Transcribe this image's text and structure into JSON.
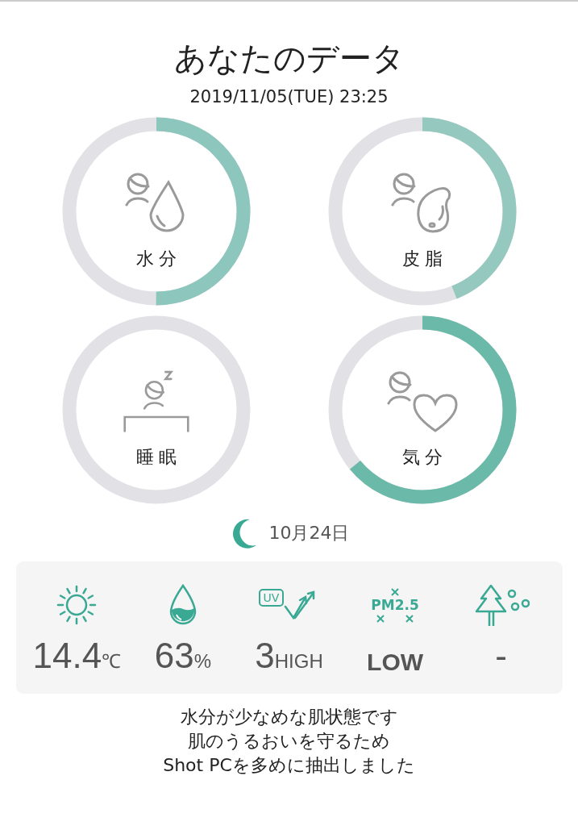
{
  "title": "あなたのデータ",
  "datetime": "2019/11/05(TUE) 23:25",
  "rings": [
    {
      "kind": "moisture",
      "label": "水分"
    },
    {
      "kind": "sebum",
      "label": "皮脂"
    },
    {
      "kind": "sleep",
      "label": "睡眠"
    },
    {
      "kind": "mood",
      "label": "気分"
    }
  ],
  "moon_date": "10月24日",
  "weather": [
    {
      "kind": "temperature",
      "value": "14.4",
      "unit": "℃"
    },
    {
      "kind": "humidity",
      "value": "63",
      "unit": "%"
    },
    {
      "kind": "uv",
      "icon_text": "UV",
      "value": "3",
      "unit": "HIGH"
    },
    {
      "kind": "pm",
      "icon_text": "PM2.5",
      "value": "LOW"
    },
    {
      "kind": "pollen",
      "value": "-"
    }
  ],
  "message": [
    "水分が少なめな肌状態です",
    "肌のうるおいを守るため",
    "Shot PCを多めに抽出しました"
  ]
}
